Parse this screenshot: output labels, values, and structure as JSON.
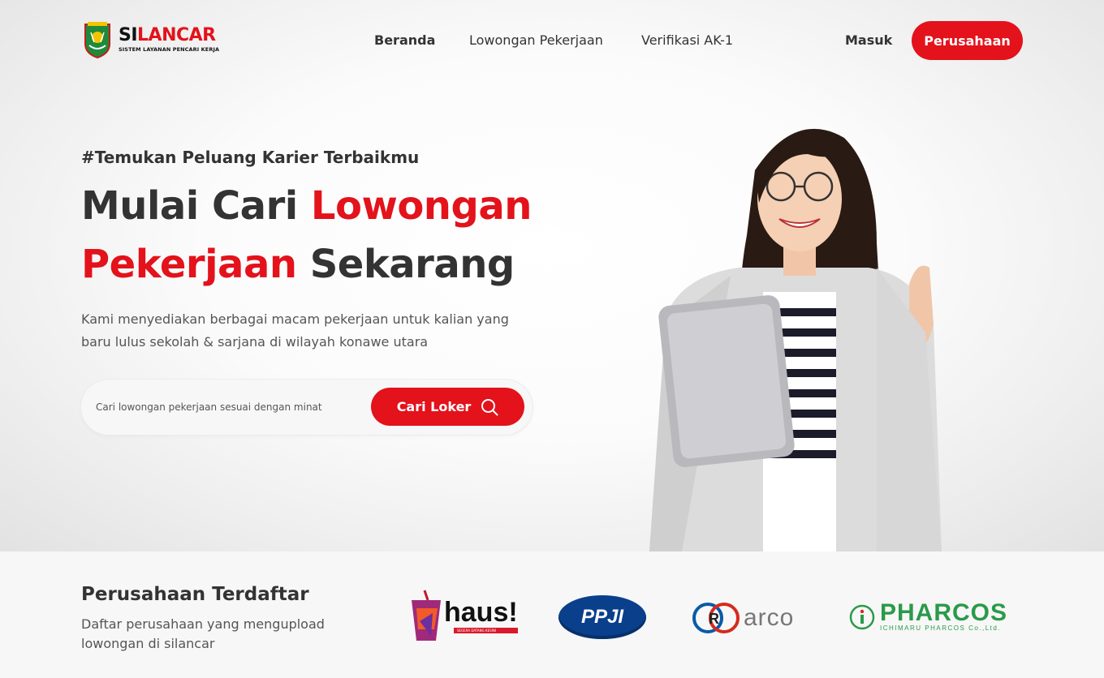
{
  "brand": {
    "name_part1": "SI",
    "name_part2": "LANCAR",
    "subtitle": "SISTEM LAYANAN PENCARI KERJA"
  },
  "nav": {
    "items": [
      {
        "label": "Beranda",
        "active": true
      },
      {
        "label": "Lowongan Pekerjaan",
        "active": false
      },
      {
        "label": "Verifikasi AK-1",
        "active": false
      }
    ],
    "login_label": "Masuk",
    "company_label": "Perusahaan"
  },
  "hero": {
    "tagline": "#Temukan Peluang Karier Terbaikmu",
    "headline_1": "Mulai Cari ",
    "headline_red_1": "Lowongan",
    "headline_red_2": "Pekerjaan",
    "headline_2": " Sekarang",
    "description": "Kami menyediakan berbagai macam pekerjaan untuk kalian yang baru lulus sekolah & sarjana di wilayah konawe utara",
    "search_placeholder": "Cari lowongan pekerjaan sesuai dengan minat",
    "search_button": "Cari Loker"
  },
  "companies": {
    "title": "Perusahaan Terdaftar",
    "subtitle": "Daftar perusahaan yang mengupload lowongan di silancar",
    "logos": [
      {
        "name": "haus!",
        "tagline": "SEGERA DATANG KESINI"
      },
      {
        "name": "PPJI"
      },
      {
        "name": "arco"
      },
      {
        "name": "PHARCOS",
        "tagline": "ICHIMARU PHARCOS Co.,Ltd."
      }
    ]
  },
  "colors": {
    "accent": "#e3121b",
    "text_dark": "#333333",
    "text_muted": "#555555"
  }
}
